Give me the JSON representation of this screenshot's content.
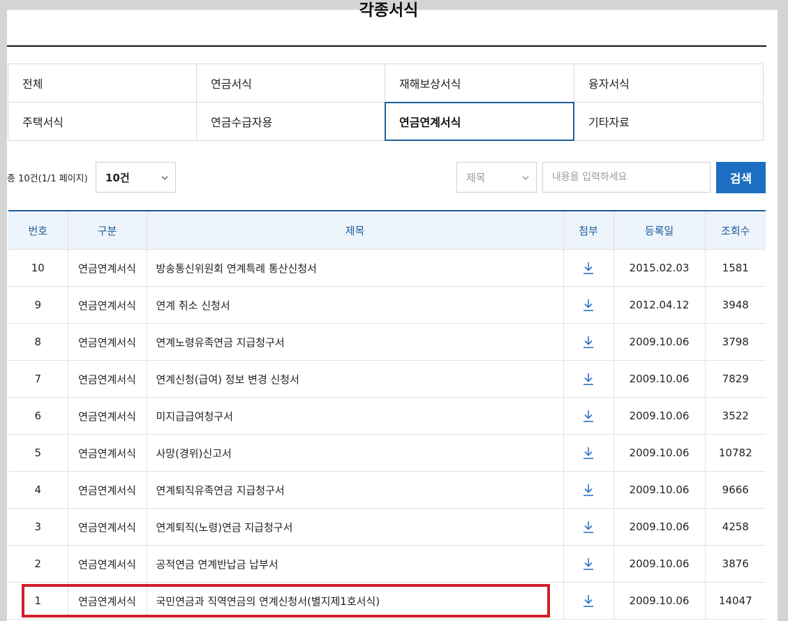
{
  "page": {
    "title": "각종서식"
  },
  "categories": [
    {
      "label": "전체",
      "active": false
    },
    {
      "label": "연금서식",
      "active": false
    },
    {
      "label": "재해보상서식",
      "active": false
    },
    {
      "label": "융자서식",
      "active": false
    },
    {
      "label": "주택서식",
      "active": false
    },
    {
      "label": "연금수급자용",
      "active": false
    },
    {
      "label": "연금연계서식",
      "active": true
    },
    {
      "label": "기타자료",
      "active": false
    }
  ],
  "toolbar": {
    "count_text": "총 10건(1/1 페이지)",
    "per_page_value": "10건",
    "search_field_value": "제목",
    "search_placeholder": "내용을 입력하세요",
    "search_button_label": "검색"
  },
  "table": {
    "headers": [
      "번호",
      "구분",
      "제목",
      "첨부",
      "등록일",
      "조회수"
    ],
    "rows": [
      {
        "no": "10",
        "category": "연금연계서식",
        "title": "방송통신위원회 연계특례 통산신청서",
        "attachment": "download-icon",
        "date": "2015.02.03",
        "views": "1581"
      },
      {
        "no": "9",
        "category": "연금연계서식",
        "title": "연계 취소 신청서",
        "attachment": "download-icon",
        "date": "2012.04.12",
        "views": "3948"
      },
      {
        "no": "8",
        "category": "연금연계서식",
        "title": "연계노령유족연금 지급청구서",
        "attachment": "download-icon",
        "date": "2009.10.06",
        "views": "3798"
      },
      {
        "no": "7",
        "category": "연금연계서식",
        "title": "연계신청(급여) 정보 변경 신청서",
        "attachment": "download-icon",
        "date": "2009.10.06",
        "views": "7829"
      },
      {
        "no": "6",
        "category": "연금연계서식",
        "title": "미지급급여청구서",
        "attachment": "download-icon",
        "date": "2009.10.06",
        "views": "3522"
      },
      {
        "no": "5",
        "category": "연금연계서식",
        "title": "사망(경위)신고서",
        "attachment": "download-icon",
        "date": "2009.10.06",
        "views": "10782"
      },
      {
        "no": "4",
        "category": "연금연계서식",
        "title": "연계퇴직유족연금 지급청구서",
        "attachment": "download-icon",
        "date": "2009.10.06",
        "views": "9666"
      },
      {
        "no": "3",
        "category": "연금연계서식",
        "title": "연계퇴직(노령)연금 지급청구서",
        "attachment": "download-icon",
        "date": "2009.10.06",
        "views": "4258"
      },
      {
        "no": "2",
        "category": "연금연계서식",
        "title": "공적연금 연계반납금 납부서",
        "attachment": "download-icon",
        "date": "2009.10.06",
        "views": "3876"
      },
      {
        "no": "1",
        "category": "연금연계서식",
        "title": "국민연금과 직역연금의 연계신청서(별지제1호서식)",
        "attachment": "download-icon",
        "date": "2009.10.06",
        "views": "14047"
      }
    ]
  },
  "colors": {
    "accent": "#1b6ec2",
    "header_text": "#1a5c9a",
    "highlight": "#d0202a"
  }
}
